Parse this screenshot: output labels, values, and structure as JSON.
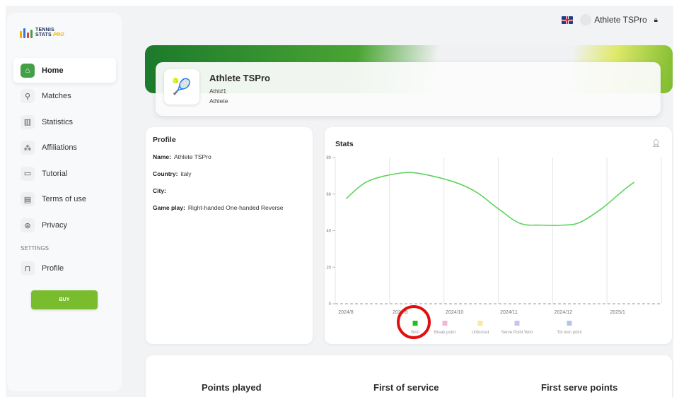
{
  "logo": {
    "line1": "TENNIS",
    "line2": "STATS",
    "line3": "PRO"
  },
  "header": {
    "username": "Athlete TSPro"
  },
  "sidebar": {
    "items": [
      {
        "label": "Home",
        "icon": "home-icon",
        "active": true
      },
      {
        "label": "Matches",
        "icon": "racket-icon"
      },
      {
        "label": "Statistics",
        "icon": "chart-icon"
      },
      {
        "label": "Affiliations",
        "icon": "affiliations-icon"
      },
      {
        "label": "Tutorial",
        "icon": "tutorial-icon"
      },
      {
        "label": "Terms of use",
        "icon": "document-icon"
      },
      {
        "label": "Privacy",
        "icon": "privacy-icon"
      }
    ],
    "settings_label": "SETTINGS",
    "settings_items": [
      {
        "label": "Profile",
        "icon": "lock-icon"
      }
    ],
    "buy_label": "BUY"
  },
  "profile_card": {
    "name": "Athlete TSPro",
    "id": "Athl#1",
    "role": "Athlete"
  },
  "profile_panel": {
    "title": "Profile",
    "name_key": "Name:",
    "name_value": "Athlete TSPro",
    "country_key": "Country:",
    "country_value": "italy",
    "city_key": "City:",
    "city_value": "",
    "gameplay_key": "Game play:",
    "gameplay_value": "Right-handed One-handed Reverse"
  },
  "stats": {
    "title": "Stats"
  },
  "chart_data": {
    "type": "line",
    "x": [
      "2024/8",
      "2024/9",
      "2024/10",
      "2024/11",
      "2024/12",
      "2025/1"
    ],
    "ylim": [
      0,
      80
    ],
    "yticks": [
      0,
      20,
      40,
      60,
      80
    ],
    "series": [
      {
        "name": "Won",
        "color": "#5fd35f",
        "points": [
          [
            0.2,
            57.5
          ],
          [
            0.6,
            67
          ],
          [
            1.2,
            71.5
          ],
          [
            1.6,
            71
          ],
          [
            2.2,
            66.5
          ],
          [
            2.6,
            61
          ],
          [
            3.0,
            52
          ],
          [
            3.4,
            44
          ],
          [
            3.8,
            43
          ],
          [
            4.2,
            43
          ],
          [
            4.5,
            44.5
          ],
          [
            4.9,
            52
          ],
          [
            5.3,
            62
          ],
          [
            5.5,
            66.5
          ]
        ]
      },
      {
        "name": "Break point",
        "color": "#f2b8d6",
        "points": []
      },
      {
        "name": "Unforced",
        "color": "#f6e9a2",
        "points": []
      },
      {
        "name": "Serve Point Won",
        "color": "#c9c2f1",
        "points": []
      },
      {
        "name": "Tot won point",
        "color": "#b7c4ea",
        "points": []
      }
    ],
    "legend": [
      {
        "name": "Won",
        "color": "#19c21e"
      },
      {
        "name": "Break point",
        "color": "#f2b8d6"
      },
      {
        "name": "Unforced",
        "color": "#f6e9a2"
      },
      {
        "name": "Serve Point Won",
        "color": "#c9c2f1"
      },
      {
        "name": "Tot won point",
        "color": "#b7c4ea"
      }
    ],
    "legend_position": "bottom",
    "grid": true
  },
  "metrics": {
    "points_played": "Points played",
    "first_of_service": "First of service",
    "first_serve_points": "First serve points"
  }
}
